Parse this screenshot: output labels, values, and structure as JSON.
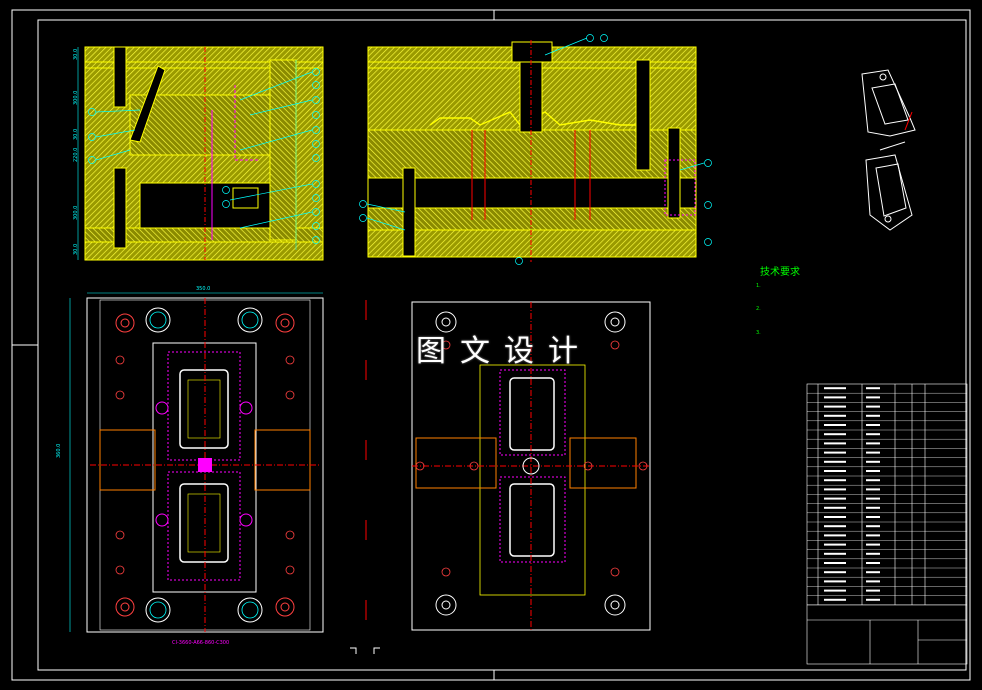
{
  "watermark": "图文设计",
  "tech_requirements": {
    "title": "技术要求",
    "lines": [
      "1.",
      "",
      "2.",
      "",
      "3.",
      "",
      ""
    ]
  },
  "dimensions": {
    "plan_width": "350.0",
    "plan_height": "360.0",
    "plan_caption": "CI-3660-A66-860-C300",
    "section_dims": [
      "30.0",
      "300.0",
      "30.0",
      "220.0",
      "300.0",
      "30.0"
    ]
  },
  "colors": {
    "background": "#000000",
    "mold_fill": "#ffff00",
    "hatch": "#c8c800",
    "outline": "#ffffff",
    "centerline": "#ff0000",
    "dimension": "#00ffff",
    "text_green": "#00ff00",
    "magenta": "#ff00ff",
    "orange": "#ff8000"
  }
}
